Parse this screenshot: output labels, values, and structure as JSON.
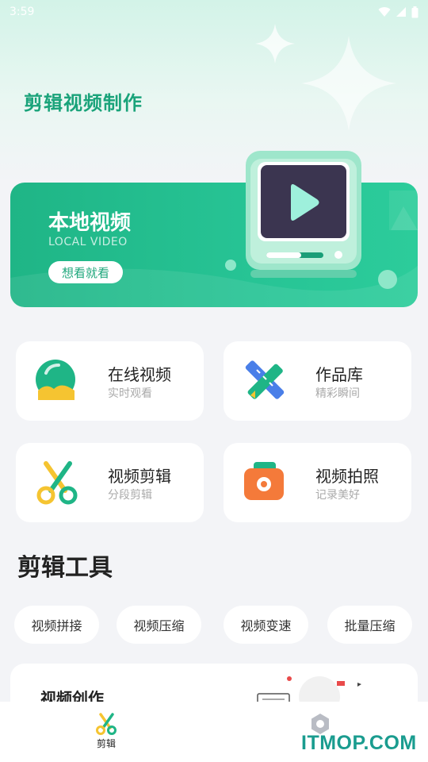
{
  "status_bar": {
    "time": "3:59"
  },
  "app_title": "剪辑视频制作",
  "banner": {
    "title": "本地视频",
    "subtitle": "LOCAL VIDEO",
    "button_label": "想看就看"
  },
  "cards": [
    {
      "title": "在线视频",
      "subtitle": "实时观看"
    },
    {
      "title": "作品库",
      "subtitle": "精彩瞬间"
    },
    {
      "title": "视频剪辑",
      "subtitle": "分段剪辑"
    },
    {
      "title": "视频拍照",
      "subtitle": "记录美好"
    }
  ],
  "tools": {
    "title": "剪辑工具",
    "chips": [
      "视频拼接",
      "视频压缩",
      "视频变速",
      "批量压缩"
    ]
  },
  "create_card": {
    "title": "视频创作"
  },
  "bottom_nav": {
    "items": [
      {
        "label": "剪辑",
        "icon": "scissors-icon",
        "active": true
      },
      {
        "label": "",
        "icon": "gear-icon",
        "active": false
      }
    ]
  },
  "watermark": "ITMOP.COM",
  "colors": {
    "accent": "#1fb586",
    "title_green": "#1aa37a",
    "orange": "#f47a3a",
    "yellow": "#f5c431"
  }
}
